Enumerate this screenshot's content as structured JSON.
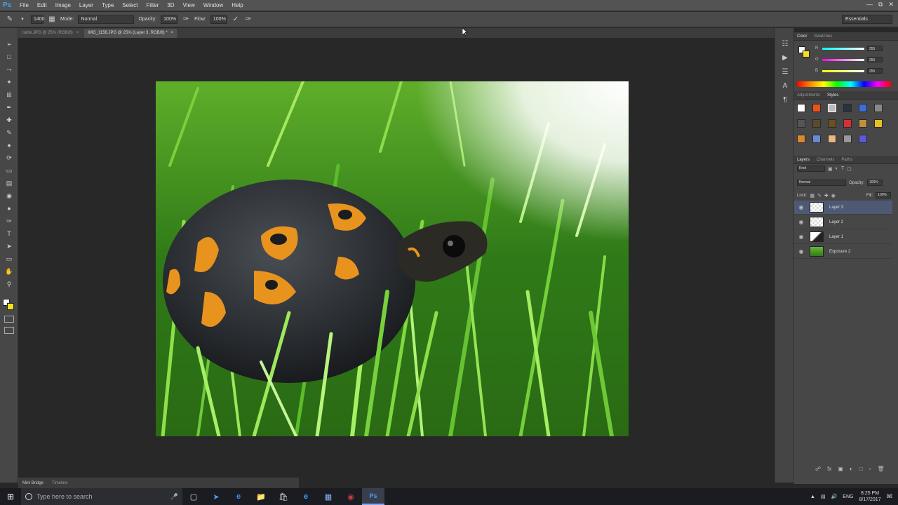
{
  "app": {
    "logo": "Ps"
  },
  "menu": [
    "File",
    "Edit",
    "Image",
    "Layer",
    "Type",
    "Select",
    "Filter",
    "3D",
    "View",
    "Window",
    "Help"
  ],
  "options": {
    "brush_size": "1400",
    "mode_label": "Mode:",
    "mode_value": "Normal",
    "opacity_label": "Opacity:",
    "opacity_value": "100%",
    "flow_label": "Flow:",
    "flow_value": "100%",
    "workspace": "Essentials"
  },
  "tabs": [
    {
      "label": "turtle.JPG @ 25% (RGB/8)"
    },
    {
      "label": "IMG_1156.JPG @ 25% (Layer 3, RGB/8) *"
    }
  ],
  "colors": {
    "foreground": "#ffffff",
    "background": "#f0e21a",
    "accent_selected": "#4e5a74"
  },
  "color_panel": {
    "tabs": [
      "Color",
      "Swatches"
    ],
    "sliders": [
      {
        "letter": "R",
        "value": "255"
      },
      {
        "letter": "G",
        "value": "255"
      },
      {
        "letter": "B",
        "value": "255"
      }
    ]
  },
  "styles_panel": {
    "tabs": [
      "Adjustments",
      "Styles"
    ]
  },
  "layers_panel": {
    "tabs": [
      "Layers",
      "Channels",
      "Paths"
    ],
    "kind": "Kind",
    "blend": "Normal",
    "opacity_label": "Opacity:",
    "opacity_value": "100%",
    "lock_label": "Lock:",
    "fill_label": "Fill:",
    "fill_value": "100%",
    "layers": [
      {
        "name": "Layer 3",
        "selected": true
      },
      {
        "name": "Layer 2",
        "selected": false
      },
      {
        "name": "Layer 1",
        "selected": false
      },
      {
        "name": "Exposure 2",
        "selected": false
      }
    ]
  },
  "minibridge": {
    "tabs": [
      "Mini Bridge",
      "Timeline"
    ]
  },
  "taskbar": {
    "search_placeholder": "Type here to search",
    "language": "ENG",
    "time": "8:25 PM",
    "date": "8/17/2017"
  }
}
